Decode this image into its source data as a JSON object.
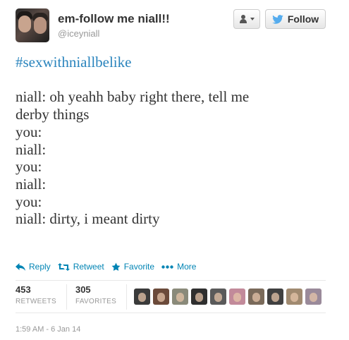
{
  "user": {
    "full_name": "em-follow me niall!!",
    "screen_name": "@iceyniall"
  },
  "header_buttons": {
    "follow_label": "Follow"
  },
  "tweet": {
    "hashtag": "#sexwithniallbelike",
    "lines": [
      "niall: oh yeahh baby right there, tell me",
      "derby things",
      "you:",
      "niall:",
      "you:",
      "niall:",
      "you:",
      "niall: dirty, i meant dirty"
    ]
  },
  "actions": {
    "reply": "Reply",
    "retweet": "Retweet",
    "favorite": "Favorite",
    "more": "More"
  },
  "stats": {
    "retweets_count": "453",
    "retweets_label": "RETWEETS",
    "favorites_count": "305",
    "favorites_label": "FAVORITES"
  },
  "favoriters": [
    {
      "icon": "user-avatar",
      "color": "#3a3a3a"
    },
    {
      "icon": "user-avatar",
      "color": "#6b4a3a"
    },
    {
      "icon": "user-avatar",
      "color": "#8a8a7a"
    },
    {
      "icon": "user-avatar",
      "color": "#2f2f2f"
    },
    {
      "icon": "user-avatar",
      "color": "#5a5a5a"
    },
    {
      "icon": "user-avatar",
      "color": "#c28a9a"
    },
    {
      "icon": "user-avatar",
      "color": "#7a6a5a"
    },
    {
      "icon": "user-avatar",
      "color": "#404040"
    },
    {
      "icon": "user-avatar",
      "color": "#a08a70"
    },
    {
      "icon": "user-avatar",
      "color": "#9a8a9a"
    }
  ],
  "timestamp": "1:59 AM - 6 Jan 14",
  "colors": {
    "link": "#0084b4",
    "hashtag": "#2a84bd",
    "twitter_blue": "#55acee"
  }
}
